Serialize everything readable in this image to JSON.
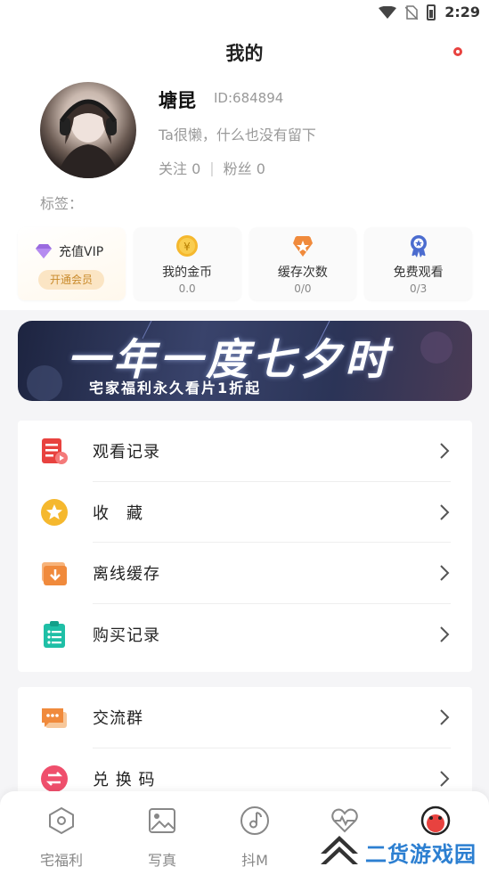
{
  "status_bar": {
    "time": "2:29"
  },
  "page": {
    "title": "我的"
  },
  "profile": {
    "name": "塘昆",
    "id": "ID:684894",
    "bio": "Ta很懒，什么也没有留下",
    "following": "关注 0",
    "separator": "|",
    "fans": "粉丝 0",
    "tags_label": "标签："
  },
  "cards": {
    "vip": {
      "title": "充值VIP",
      "button": "开通会员"
    },
    "coins": {
      "title": "我的金币",
      "value": "0.0"
    },
    "cache": {
      "title": "缓存次数",
      "value": "0/0"
    },
    "free": {
      "title": "免费观看",
      "value": "0/3"
    }
  },
  "banner": {
    "title": "一年一度七夕时",
    "subtitle": "宅家福利永久看片1折起"
  },
  "menu": {
    "history": "观看记录",
    "favorites": "收　藏",
    "offline": "离线缓存",
    "purchases": "购买记录",
    "group": "交流群",
    "redeem": "兑 换 码"
  },
  "tabbar": {
    "tabs": [
      "宅福利",
      "写真",
      "抖M",
      "",
      ""
    ]
  },
  "watermark": {
    "text": "二货游戏园"
  },
  "colors": {
    "accent_red": "#e8423f",
    "gold": "#f5b82e",
    "orange": "#f08a3c",
    "teal": "#1fbfa6",
    "vip_orange": "#c98a2b",
    "watermark_blue": "#2c7fd1"
  }
}
